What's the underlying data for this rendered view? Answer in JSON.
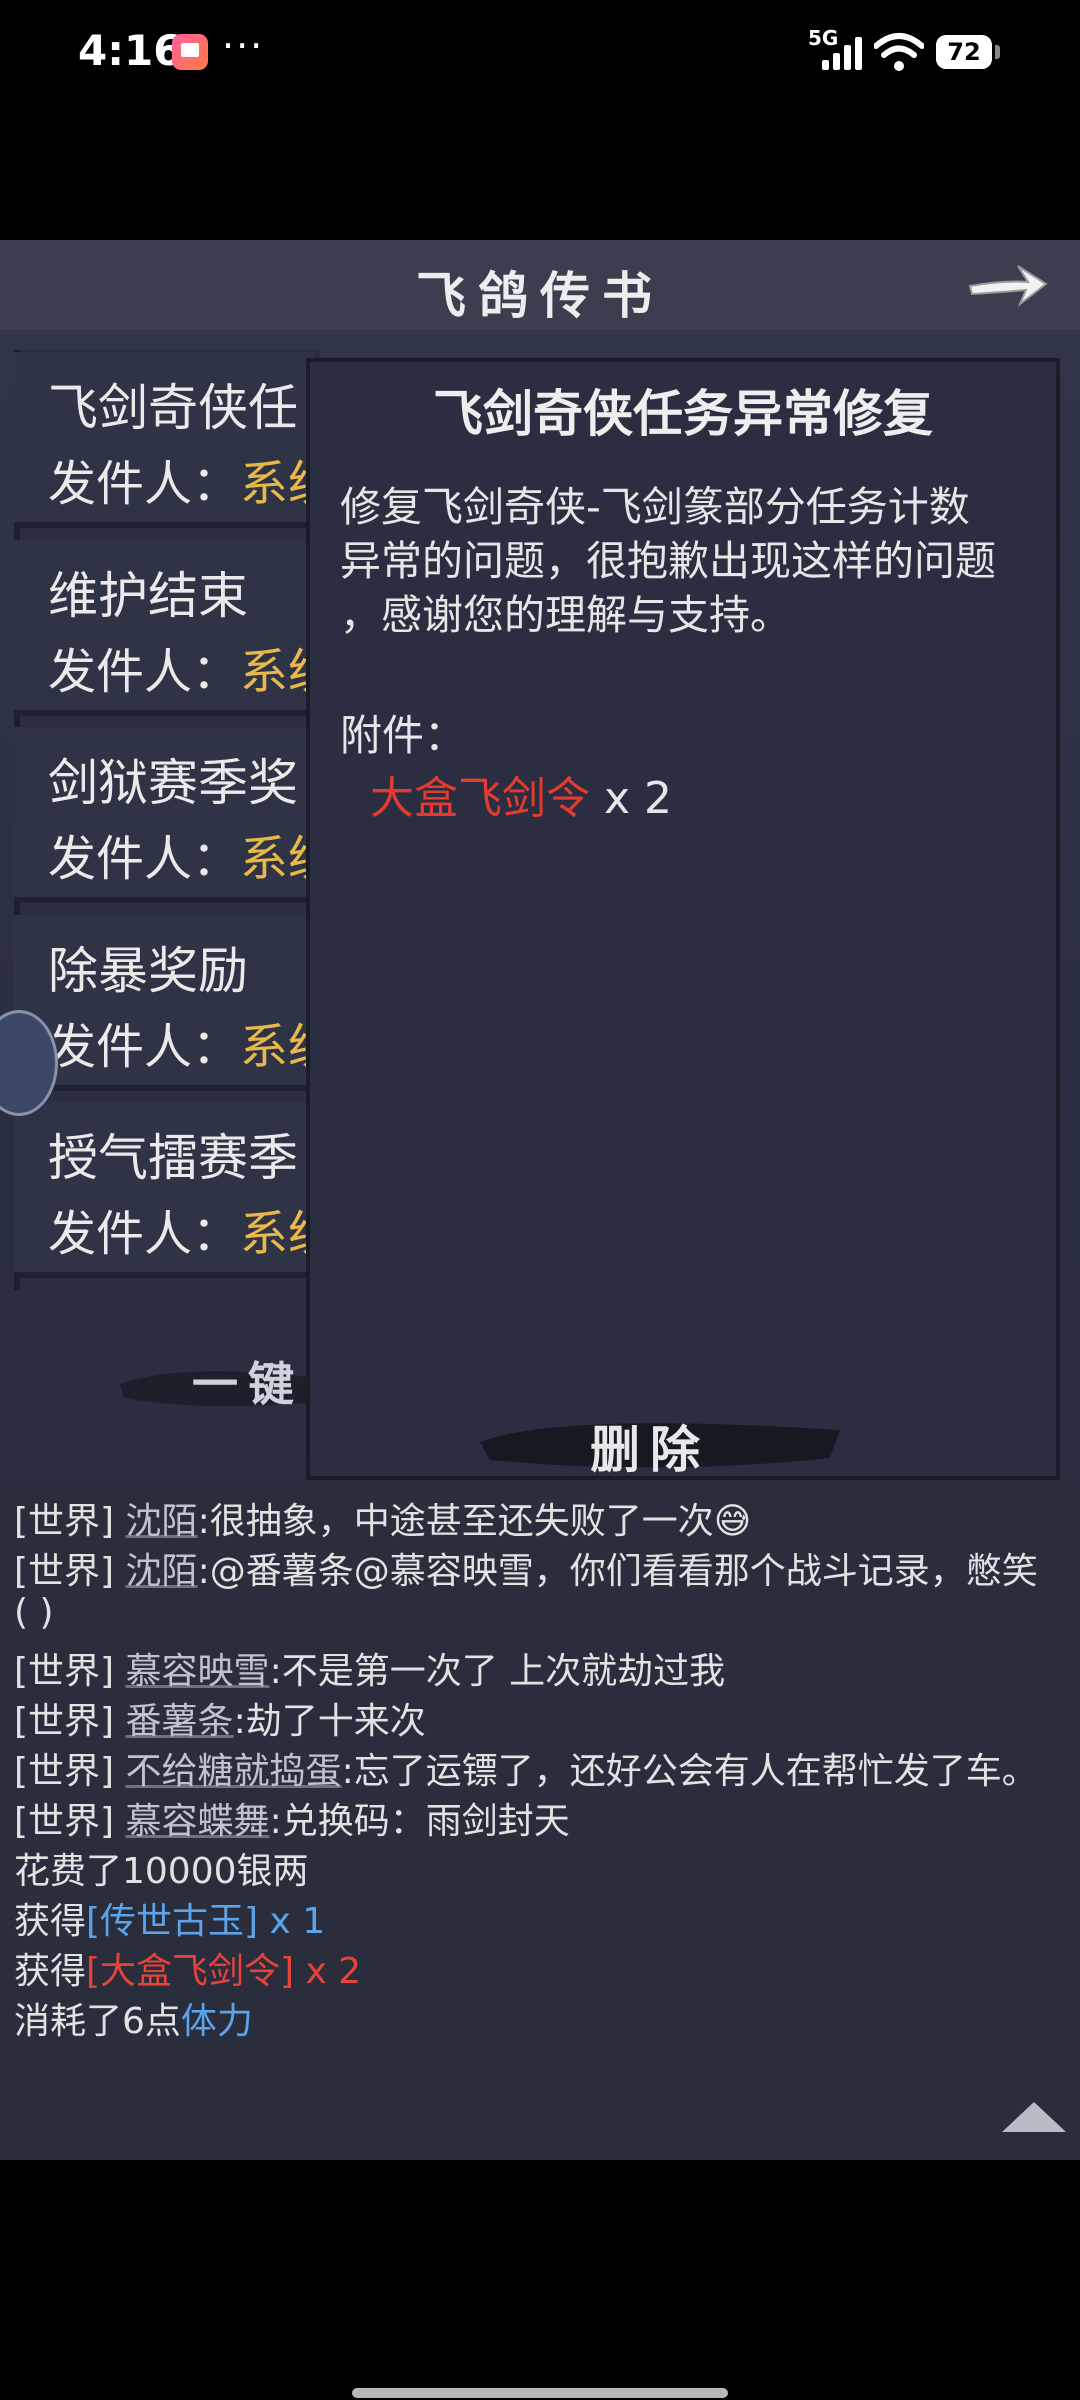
{
  "status_bar": {
    "time": "4:16",
    "network": "5G",
    "battery": "72",
    "more": "···"
  },
  "header": {
    "title": "飞鸽传书",
    "arrow_icon": "right-arrow-icon"
  },
  "mail_list": {
    "sender_label": "发件人：",
    "items": [
      {
        "subject": "飞剑奇侠任",
        "sender": "系统"
      },
      {
        "subject": "维护结束",
        "sender": "系统"
      },
      {
        "subject": "剑狱赛季奖",
        "sender": "系统"
      },
      {
        "subject": "除暴奖励",
        "sender": "系统"
      },
      {
        "subject": "授气擂赛季",
        "sender": "系统"
      }
    ],
    "bulk_button_label": "一键"
  },
  "mail_detail": {
    "title": "飞剑奇侠任务异常修复",
    "body_lines": [
      "修复飞剑奇侠-飞剑篆部分任务计数",
      "异常的问题，很抱歉出现这样的问题",
      "，感谢您的理解与支持。"
    ],
    "attachment_label": "附件：",
    "attachment_name": "大盒飞剑令",
    "attachment_qty": "x 2",
    "delete_label": "删除"
  },
  "chat": {
    "lines": [
      {
        "channel": "[世界]",
        "user": "沈陌",
        "text": ":很抽象，中途甚至还失败了一次😅"
      },
      {
        "channel": "[世界]",
        "user": "沈陌",
        "text": ":@番薯条@慕容映雪，你们看看那个战斗记录，憋笑"
      },
      {
        "channel": "",
        "user": "",
        "text": "( )"
      },
      {
        "channel": "[世界]",
        "user": "慕容映雪",
        "text": ":不是第一次了 上次就劫过我"
      },
      {
        "channel": "[世界]",
        "user": "番薯条",
        "text": ":劫了十来次"
      },
      {
        "channel": "[世界]",
        "user": "不给糖就捣蛋",
        "text": ":忘了运镖了，还好公会有人在帮忙发了车。"
      },
      {
        "channel": "[世界]",
        "user": "慕容蝶舞",
        "text": ":兑换码：雨剑封天"
      }
    ],
    "spent_text": "花费了10000银两",
    "gain1_prefix": "获得",
    "gain1_item": "[传世古玉] x 1",
    "gain2_prefix": "获得",
    "gain2_item": "[大盒飞剑令] x 2",
    "consume_prefix": "消耗了6点",
    "consume_item": "体力"
  },
  "colors": {
    "sender_gold": "#e8b84a",
    "item_red": "#e43b30",
    "item_blue": "#5da3ea"
  }
}
